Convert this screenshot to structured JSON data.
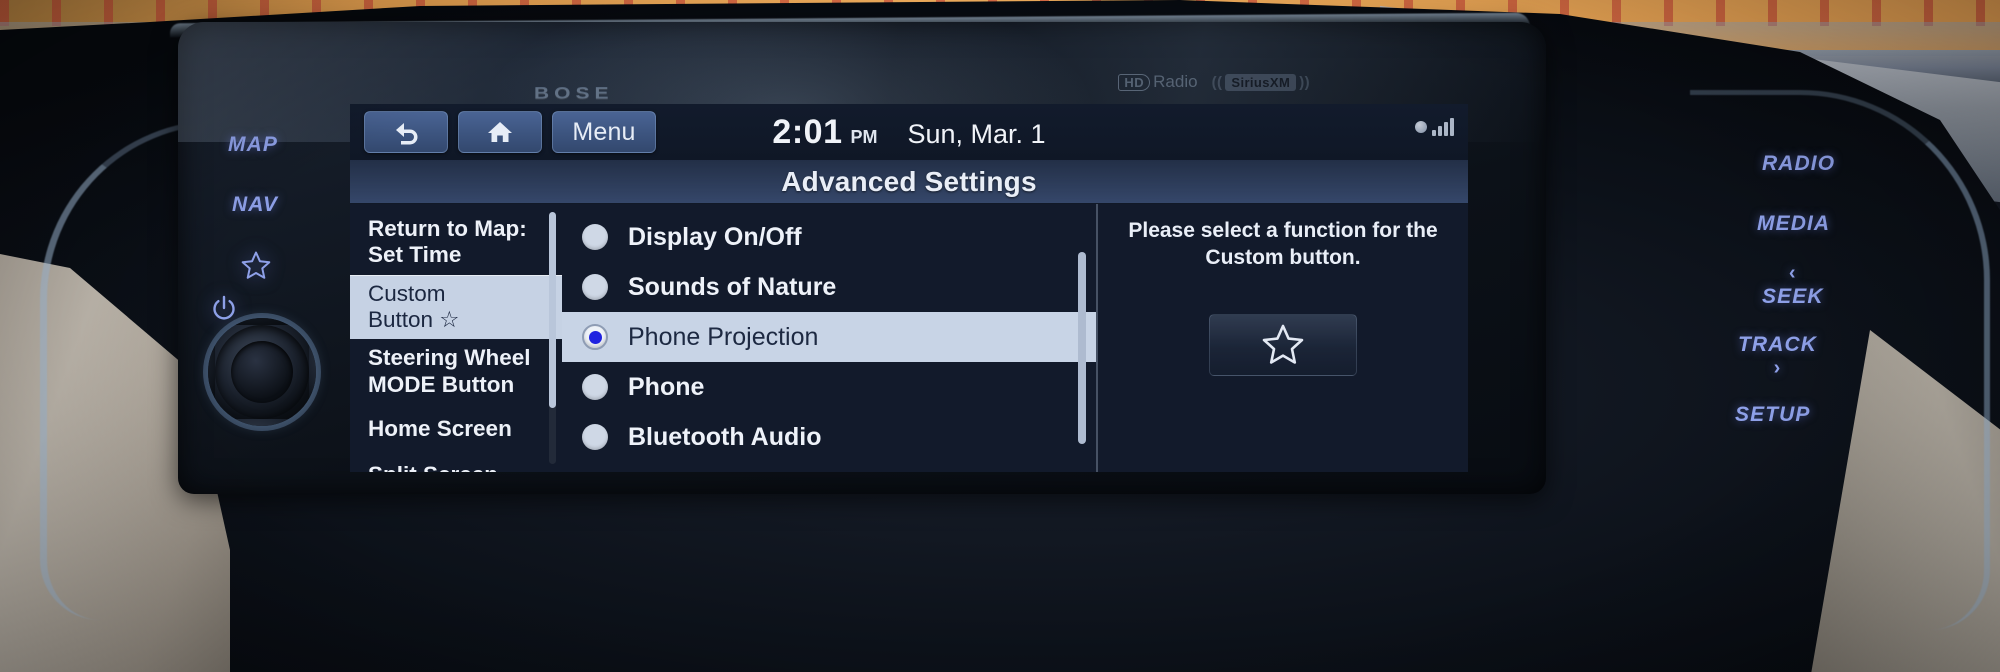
{
  "device": {
    "brand_logo": "BOSE",
    "badges": {
      "hd_radio_mark": "HD",
      "hd_radio_label": "Radio",
      "siriusxm_label": "SiriusXM"
    }
  },
  "topbar": {
    "back_icon": "back-arrow-icon",
    "home_icon": "home-icon",
    "menu_label": "Menu",
    "time": "2:01",
    "ampm": "PM",
    "date": "Sun, Mar. 1",
    "signal_icon": "satellite-signal-icon"
  },
  "title": "Advanced Settings",
  "sidebar": {
    "items": [
      {
        "line1": "Return to Map:",
        "line2": "Set Time",
        "selected": false
      },
      {
        "line1": "Custom",
        "line2": "Button ☆",
        "selected": true
      },
      {
        "line1": "Steering Wheel",
        "line2": "MODE Button",
        "selected": false
      },
      {
        "line1": "Home Screen",
        "line2": "",
        "selected": false
      },
      {
        "line1": "Split Screen",
        "line2": "",
        "selected": false
      }
    ]
  },
  "options": {
    "items": [
      {
        "label": "Display On/Off",
        "selected": false
      },
      {
        "label": "Sounds of Nature",
        "selected": false
      },
      {
        "label": "Phone Projection",
        "selected": true
      },
      {
        "label": "Phone",
        "selected": false
      },
      {
        "label": "Bluetooth Audio",
        "selected": false
      }
    ]
  },
  "info": {
    "message_line1": "Please select a function for the",
    "message_line2": "Custom button.",
    "preview_icon": "star-outline-icon"
  },
  "hardware": {
    "left": [
      {
        "label": "MAP",
        "type": "text"
      },
      {
        "label": "NAV",
        "type": "text"
      },
      {
        "label": "",
        "type": "star-icon"
      },
      {
        "label": "",
        "type": "power-icon"
      }
    ],
    "right": [
      {
        "label": "RADIO",
        "chevron": ""
      },
      {
        "label": "MEDIA",
        "chevron": ""
      },
      {
        "label": "SEEK",
        "chevron": "‹",
        "chevron_pos": "above"
      },
      {
        "label": "TRACK",
        "chevron": "›",
        "chevron_pos": "below"
      },
      {
        "label": "SETUP",
        "chevron": ""
      }
    ],
    "volume_knob": "volume-knob"
  },
  "colors": {
    "accent_blue": "#8ea0e8",
    "selected_row_bg": "#c8d4e6",
    "radio_dot": "#1f22e0",
    "titlebar_bg": "#35476a",
    "screen_bg": "#121a2b",
    "button_blue": "#3d5580"
  }
}
